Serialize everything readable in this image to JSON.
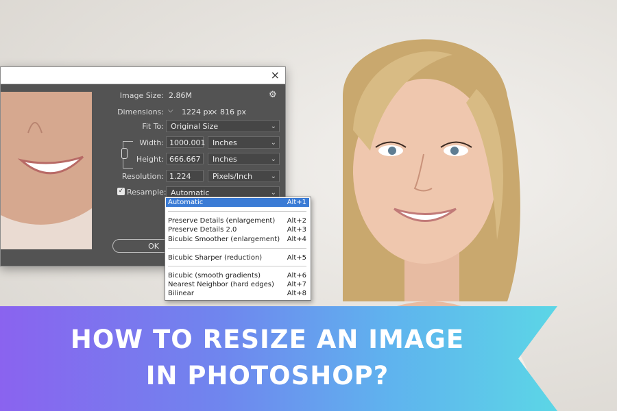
{
  "dialog": {
    "close_glyph": "×",
    "image_size": {
      "label": "Image Size:",
      "value": "2.86M"
    },
    "dimensions": {
      "label": "Dimensions:",
      "width": "1224 px",
      "times": "×",
      "height": "816 px"
    },
    "fit_to": {
      "label": "Fit To:",
      "value": "Original Size"
    },
    "width": {
      "label": "Width:",
      "value": "1000.001",
      "unit": "Inches"
    },
    "height": {
      "label": "Height:",
      "value": "666.667",
      "unit": "Inches"
    },
    "resolution": {
      "label": "Resolution:",
      "value": "1.224",
      "unit": "Pixels/Inch"
    },
    "resample": {
      "label": "Resample:",
      "value": "Automatic",
      "checked": true
    },
    "ok_label": "OK",
    "icons": [
      "gear-icon",
      "chevron-down-icon",
      "chain-link-icon",
      "close-icon"
    ]
  },
  "resample_menu": {
    "items": [
      {
        "label": "Automatic",
        "shortcut": "Alt+1",
        "selected": true
      },
      {
        "label": "Preserve Details (enlargement)",
        "shortcut": "Alt+2"
      },
      {
        "label": "Preserve Details 2.0",
        "shortcut": "Alt+3"
      },
      {
        "label": "Bicubic Smoother (enlargement)",
        "shortcut": "Alt+4"
      },
      {
        "label": "Bicubic Sharper (reduction)",
        "shortcut": "Alt+5"
      },
      {
        "label": "Bicubic (smooth gradients)",
        "shortcut": "Alt+6"
      },
      {
        "label": "Nearest Neighbor (hard edges)",
        "shortcut": "Alt+7"
      },
      {
        "label": "Bilinear",
        "shortcut": "Alt+8"
      }
    ]
  },
  "banner": {
    "line1": "HOW TO RESIZE AN IMAGE",
    "line2": "IN PHOTOSHOP?"
  },
  "colors": {
    "dialog_bg": "#535353",
    "menu_selected": "#3a7bd5",
    "banner_start": "#8a63ef",
    "banner_end": "#5cd6e6"
  }
}
